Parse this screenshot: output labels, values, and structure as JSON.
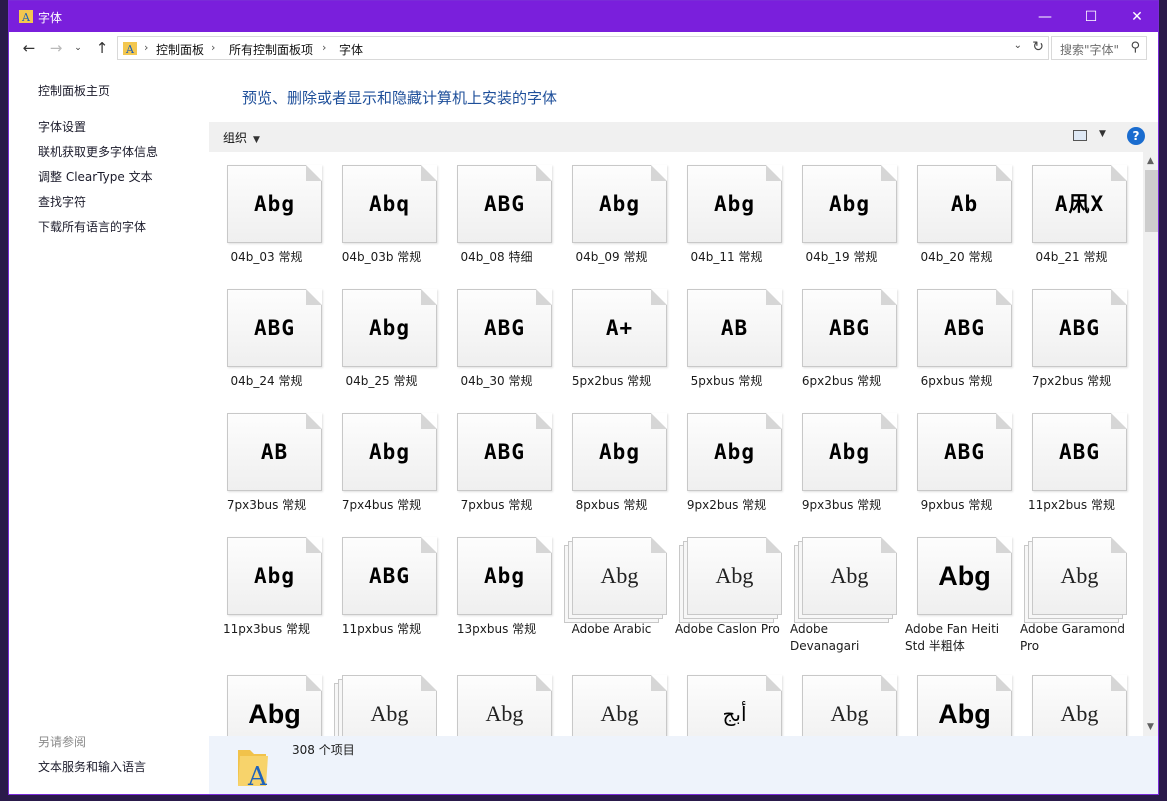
{
  "window": {
    "title": "字体",
    "controls": [
      "—",
      "☐",
      "✕"
    ]
  },
  "address": {
    "crumbs": [
      "控制面板",
      "所有控制面板项",
      "字体"
    ],
    "search_placeholder": "搜索\"字体\""
  },
  "sidebar": {
    "home": "控制面板主页",
    "links": [
      "字体设置",
      "联机获取更多字体信息",
      "调整 ClearType 文本",
      "查找字符",
      "下载所有语言的字体"
    ],
    "see_also": "另请参阅",
    "footer_link": "文本服务和输入语言"
  },
  "main": {
    "heading": "预览、删除或者显示和隐藏计算机上安装的字体",
    "organize": "组织"
  },
  "fonts": [
    {
      "name": "04b_03 常规",
      "sample": "Abg",
      "style": "px"
    },
    {
      "name": "04b_03b 常规",
      "sample": "Abq",
      "style": "px"
    },
    {
      "name": "04b_08 特细",
      "sample": "ABG",
      "style": "px"
    },
    {
      "name": "04b_09 常规",
      "sample": "Abg",
      "style": "px"
    },
    {
      "name": "04b_11 常规",
      "sample": "Abg",
      "style": "px"
    },
    {
      "name": "04b_19 常规",
      "sample": "Abg",
      "style": "px"
    },
    {
      "name": "04b_20 常规",
      "sample": "Ab",
      "style": "px"
    },
    {
      "name": "04b_21 常规",
      "sample": "A凩X",
      "style": "px"
    },
    {
      "name": "04b_24 常规",
      "sample": "ABG",
      "style": "px"
    },
    {
      "name": "04b_25 常规",
      "sample": "Abg",
      "style": "px"
    },
    {
      "name": "04b_30 常规",
      "sample": "ABG",
      "style": "px"
    },
    {
      "name": "5px2bus 常规",
      "sample": "A+",
      "style": "px"
    },
    {
      "name": "5pxbus 常规",
      "sample": "AB",
      "style": "px"
    },
    {
      "name": "6px2bus 常规",
      "sample": "ABG",
      "style": "px"
    },
    {
      "name": "6pxbus 常规",
      "sample": "ABG",
      "style": "px"
    },
    {
      "name": "7px2bus 常规",
      "sample": "ABG",
      "style": "px"
    },
    {
      "name": "7px3bus 常规",
      "sample": "AB",
      "style": "px"
    },
    {
      "name": "7px4bus 常规",
      "sample": "Abg",
      "style": "px"
    },
    {
      "name": "7pxbus 常规",
      "sample": "ABG",
      "style": "px"
    },
    {
      "name": "8pxbus 常规",
      "sample": "Abg",
      "style": "px"
    },
    {
      "name": "9px2bus 常规",
      "sample": "Abg",
      "style": "px"
    },
    {
      "name": "9px3bus 常规",
      "sample": "Abg",
      "style": "px"
    },
    {
      "name": "9pxbus 常规",
      "sample": "ABG",
      "style": "px"
    },
    {
      "name": "11px2bus 常规",
      "sample": "ABG",
      "style": "px"
    },
    {
      "name": "11px3bus 常规",
      "sample": "Abg",
      "style": "px"
    },
    {
      "name": "11pxbus 常规",
      "sample": "ABG",
      "style": "px"
    },
    {
      "name": "13pxbus 常规",
      "sample": "Abg",
      "style": "px"
    },
    {
      "name": "Adobe Arabic",
      "sample": "Abg",
      "style": "serif",
      "stack": true
    },
    {
      "name": "Adobe Caslon Pro",
      "sample": "Abg",
      "style": "serif",
      "stack": true
    },
    {
      "name": "Adobe Devanagari",
      "sample": "Abg",
      "style": "serif",
      "stack": true
    },
    {
      "name": "Adobe Fan Heiti Std 半粗体",
      "sample": "Abg",
      "style": "sans"
    },
    {
      "name": "Adobe Garamond Pro",
      "sample": "Abg",
      "style": "serif",
      "stack": true
    },
    {
      "name": "",
      "sample": "Abg",
      "style": "sans"
    },
    {
      "name": "",
      "sample": "Abg",
      "style": "serif",
      "stack": true
    },
    {
      "name": "",
      "sample": "Abg",
      "style": "serif"
    },
    {
      "name": "",
      "sample": "Abg",
      "style": "serif"
    },
    {
      "name": "",
      "sample": "أبج",
      "style": "ar"
    },
    {
      "name": "",
      "sample": "Abg",
      "style": "serif"
    },
    {
      "name": "",
      "sample": "Abg",
      "style": "sans"
    },
    {
      "name": "",
      "sample": "Abg",
      "style": "serif"
    }
  ],
  "status": {
    "count": "308 个项目"
  }
}
